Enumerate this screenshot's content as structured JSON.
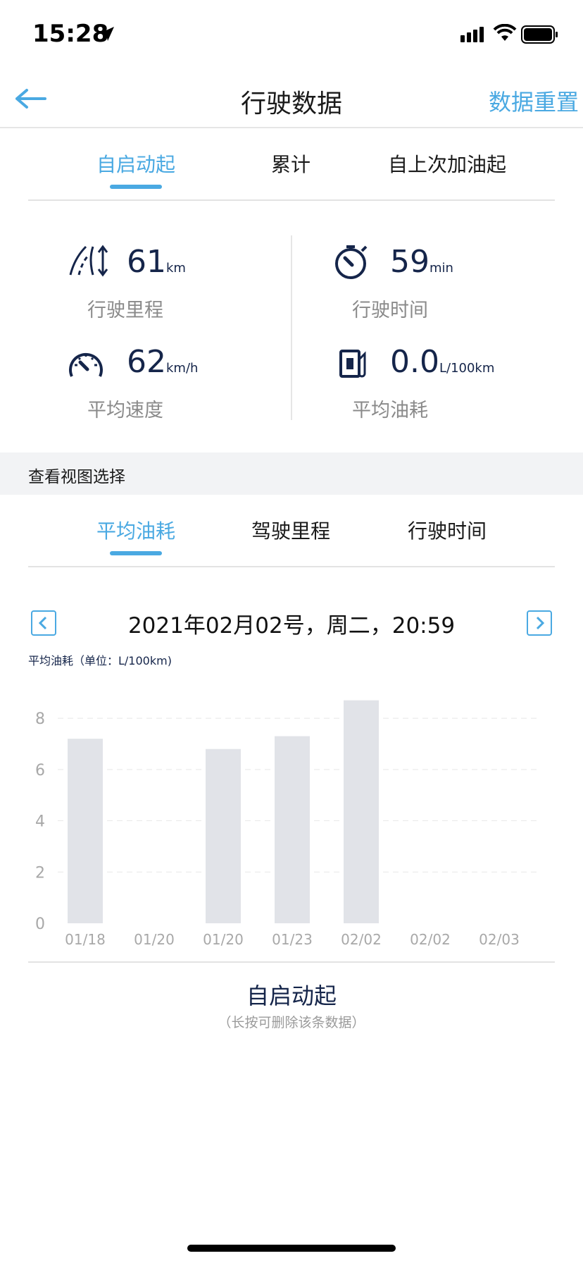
{
  "status": {
    "time": "15:28"
  },
  "nav": {
    "title": "行驶数据",
    "reset": "数据重置"
  },
  "tabs": [
    {
      "label": "自启动起",
      "active": true
    },
    {
      "label": "累计",
      "active": false
    },
    {
      "label": "自上次加油起",
      "active": false
    }
  ],
  "stats": {
    "mileage": {
      "value": "61",
      "unit": "km",
      "label": "行驶里程"
    },
    "time": {
      "value": "59",
      "unit": "min",
      "label": "行驶时间"
    },
    "speed": {
      "value": "62",
      "unit": "km/h",
      "label": "平均速度"
    },
    "fuel": {
      "value": "0.0",
      "unit": "L/100km",
      "label": "平均油耗"
    }
  },
  "view_section": {
    "label": "查看视图选择"
  },
  "view_tabs": [
    {
      "label": "平均油耗",
      "active": true
    },
    {
      "label": "驾驶里程",
      "active": false
    },
    {
      "label": "行驶时间",
      "active": false
    }
  ],
  "date_selector": {
    "text": "2021年02月02号，周二，20:59"
  },
  "chart_caption": "平均油耗（单位：L/100km)",
  "chart_data": {
    "type": "bar",
    "categories": [
      "01/18",
      "01/20",
      "01/20",
      "01/23",
      "02/02",
      "02/02",
      "02/03"
    ],
    "values": [
      7.2,
      0,
      6.8,
      7.3,
      8.7,
      0,
      0
    ],
    "ylim": [
      0,
      8.8
    ],
    "yticks": [
      0,
      2,
      4,
      6,
      8
    ],
    "grid": true,
    "bar_color": "#e1e3e8"
  },
  "footer": {
    "title": "自启动起",
    "hint": "（长按可删除该条数据）"
  },
  "colors": {
    "accent": "#4aa9e2",
    "navy": "#15254a"
  }
}
